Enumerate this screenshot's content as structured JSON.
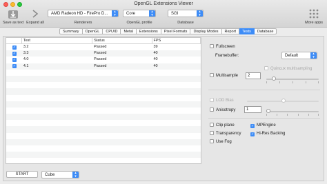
{
  "window": {
    "title": "OpenGL Extensions Viewer"
  },
  "toolbar": {
    "save_label": "Save as text",
    "expand_label": "Expand all",
    "more_label": "More apps",
    "renderer_value": "AMD Radeon HD - FirePro D...",
    "renderers_label": "Renderers",
    "profile_value": "Core",
    "profile_label": "OpenGL profile",
    "database_value": "SGI",
    "database_label": "Database"
  },
  "tabs": [
    {
      "label": "Summary"
    },
    {
      "label": "OpenGL"
    },
    {
      "label": "CPUID"
    },
    {
      "label": "Metal"
    },
    {
      "label": "Extensions"
    },
    {
      "label": "Pixel Formats"
    },
    {
      "label": "Display Modes"
    },
    {
      "label": "Report"
    },
    {
      "label": "Tests",
      "active": true
    },
    {
      "label": "Database"
    }
  ],
  "table": {
    "headers": [
      "",
      "Test",
      "Status",
      "FPS"
    ],
    "rows": [
      {
        "test": "3.2",
        "status": "Passed",
        "fps": "39"
      },
      {
        "test": "3.3",
        "status": "Passed",
        "fps": "40"
      },
      {
        "test": "4.0",
        "status": "Passed",
        "fps": "40"
      },
      {
        "test": "4.1",
        "status": "Passed",
        "fps": "40"
      }
    ]
  },
  "controls": {
    "start_label": "START",
    "scene_value": "Cube"
  },
  "options": {
    "fullscreen": "Fullscreen",
    "framebuffer_label": "Framebuffer:",
    "framebuffer_value": "Default",
    "quincux": "Quincux multisampling",
    "multisample": "Multisample",
    "multisample_value": "2",
    "lod_bias": "LOD Bias",
    "anisotropy": "Anisotropy",
    "anisotropy_value": "1",
    "clip_plane": "Clip plane",
    "mpengine": "MPEngine",
    "transparency": "Transparency",
    "hires": "Hi-Res Backing",
    "use_fog": "Use Fog"
  },
  "colors": {
    "accent": "#3d8cf7"
  }
}
